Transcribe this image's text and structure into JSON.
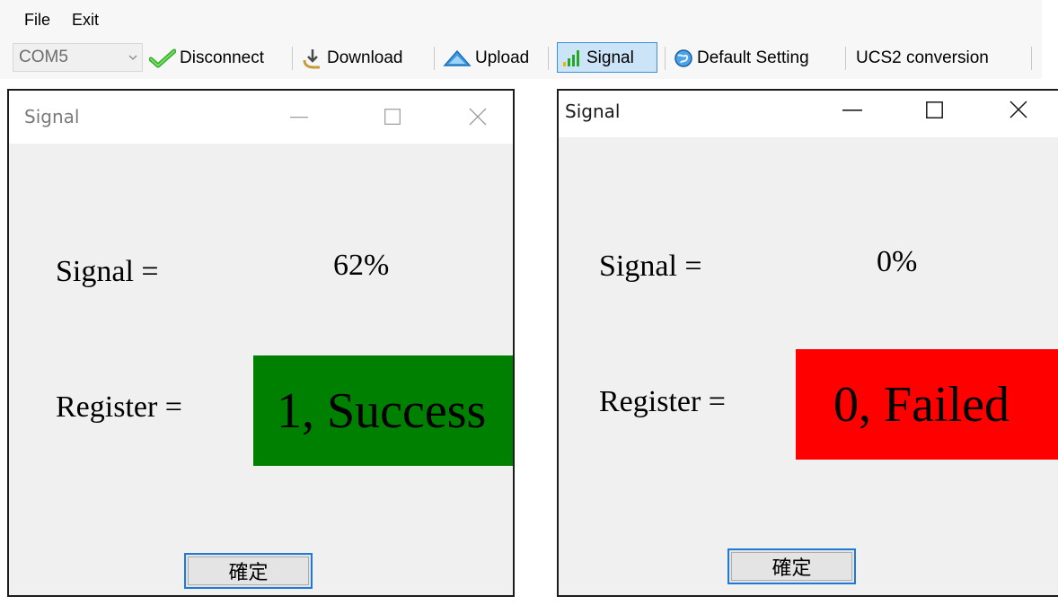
{
  "menu": {
    "file": "File",
    "exit": "Exit"
  },
  "toolbar": {
    "port": "COM5",
    "disconnect": "Disconnect",
    "download": "Download",
    "upload": "Upload",
    "signal": "Signal",
    "default_setting": "Default Setting",
    "ucs2": "UCS2 conversion"
  },
  "dialogs": [
    {
      "title": "Signal",
      "signal_label": "Signal =",
      "signal_value": "62%",
      "register_label": "Register =",
      "register_value": "1, Success",
      "register_color": "#008000",
      "ok": "確定"
    },
    {
      "title": "Signal",
      "signal_label": "Signal =",
      "signal_value": "0%",
      "register_label": "Register =",
      "register_value": "0, Failed",
      "register_color": "#ff0000",
      "ok": "確定"
    }
  ],
  "icons": {
    "disconnect": "check-icon",
    "download": "download-icon",
    "upload": "upload-icon",
    "signal": "signal-bars-icon",
    "default_setting": "globe-icon"
  },
  "colors": {
    "success": "#008000",
    "failed": "#ff0000",
    "selected_tool": "#cce4f7"
  }
}
